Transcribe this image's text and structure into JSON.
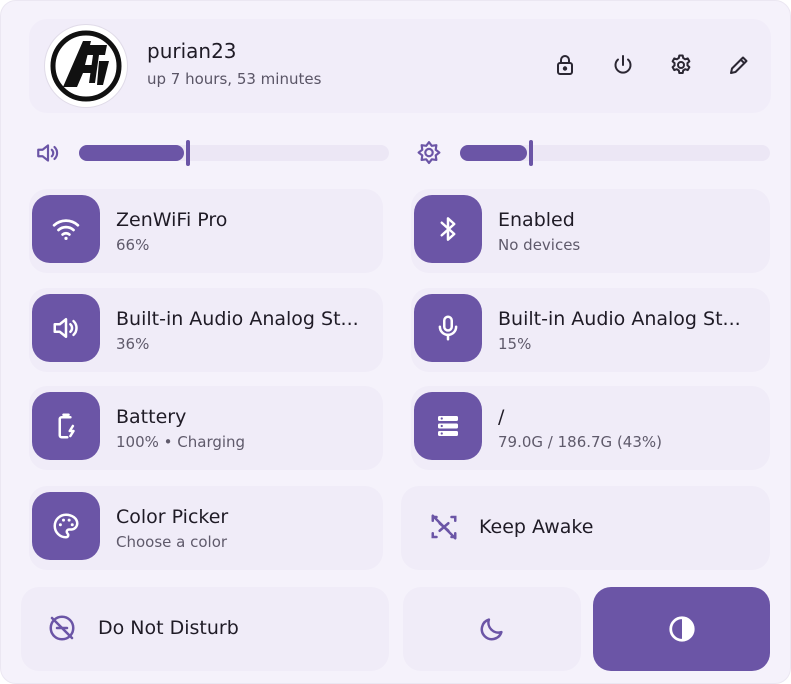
{
  "header": {
    "username": "purian23",
    "uptime": "up 7 hours, 53 minutes",
    "actions": [
      "lock-icon",
      "power-icon",
      "gear-icon",
      "pencil-icon"
    ]
  },
  "sliders": {
    "volume": {
      "icon": "volume-icon",
      "level": 0.35
    },
    "brightness": {
      "icon": "brightness-icon",
      "level": 0.23
    }
  },
  "tiles": {
    "wifi": {
      "icon": "wifi-icon",
      "title": "ZenWiFi Pro",
      "subtitle": "66%"
    },
    "bluetooth": {
      "icon": "bluetooth-icon",
      "title": "Enabled",
      "subtitle": "No devices"
    },
    "audio_output": {
      "icon": "speaker-icon",
      "title": "Built-in Audio Analog St...",
      "subtitle": "36%"
    },
    "audio_input": {
      "icon": "microphone-icon",
      "title": "Built-in Audio Analog St...",
      "subtitle": "15%"
    },
    "battery": {
      "icon": "battery-charging-icon",
      "title": "Battery",
      "subtitle": "100% • Charging"
    },
    "disk": {
      "icon": "storage-icon",
      "title": "/",
      "subtitle": "79.0G / 186.7G (43%)"
    },
    "color_picker": {
      "icon": "palette-icon",
      "title": "Color Picker",
      "subtitle": "Choose a color"
    },
    "keep_awake": {
      "icon": "keep-awake-off-icon",
      "label": "Keep Awake"
    },
    "dnd": {
      "icon": "do-not-disturb-off-icon",
      "label": "Do Not Disturb"
    }
  },
  "toggles": {
    "night_mode": {
      "icon": "moon-icon"
    },
    "dark_mode": {
      "icon": "contrast-icon"
    }
  },
  "colors": {
    "accent": "#6b55a6",
    "surface": "#f0ecf8",
    "background": "#f5f2fb",
    "text": "#1f1b26",
    "subtext": "#5f5a6b"
  }
}
